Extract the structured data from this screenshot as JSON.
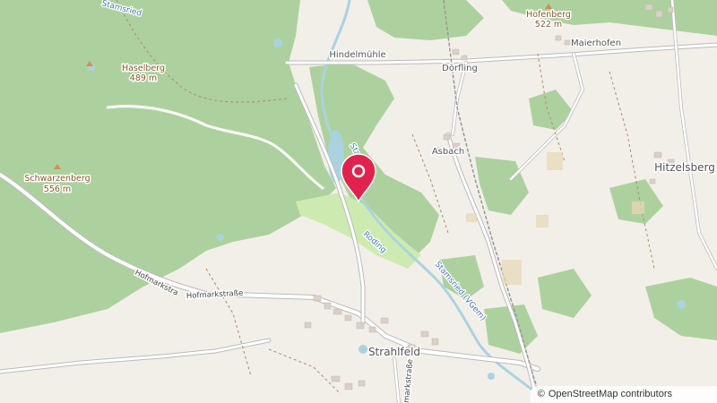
{
  "map": {
    "places": {
      "hofenberg": "Hofenberg",
      "hofenberg_ele": "522 m",
      "maierhofen": "Maierhofen",
      "hindelmuehle": "Hindelmühle",
      "doerfling": "Dörfling",
      "haselberg": "Haselberg",
      "haselberg_ele": "489 m",
      "asbach": "Asbach",
      "hitzelsberg": "Hitzelsberg",
      "schwarzenberg": "Schwarzenberg",
      "schwarzenberg_ele": "556 m",
      "strahlfeld": "Strahlfeld"
    },
    "streets": {
      "hofmarkstrasse_left": "Hofmarkstra",
      "hofmarkstrasse": "Hofmarkstraße",
      "strahlfeld_street": "Strahlfeld",
      "vertical_street": "markstraße"
    },
    "water": {
      "roding": "Roding",
      "stamsried_top": "Stamsried",
      "stamsried_mid": "Stam",
      "stamsried_vgem": "Stamsried (VGem)"
    },
    "marker": {
      "label": "Location marker",
      "color": "#e0234e"
    },
    "colors": {
      "forest": "#add19e",
      "land": "#f2efe9",
      "water": "#aad3df",
      "road": "#ffffff",
      "meadow": "#cdebb0",
      "farmland": "#eef0d5"
    }
  },
  "attribution": {
    "symbol": "©",
    "text": "OpenStreetMap contributors"
  }
}
